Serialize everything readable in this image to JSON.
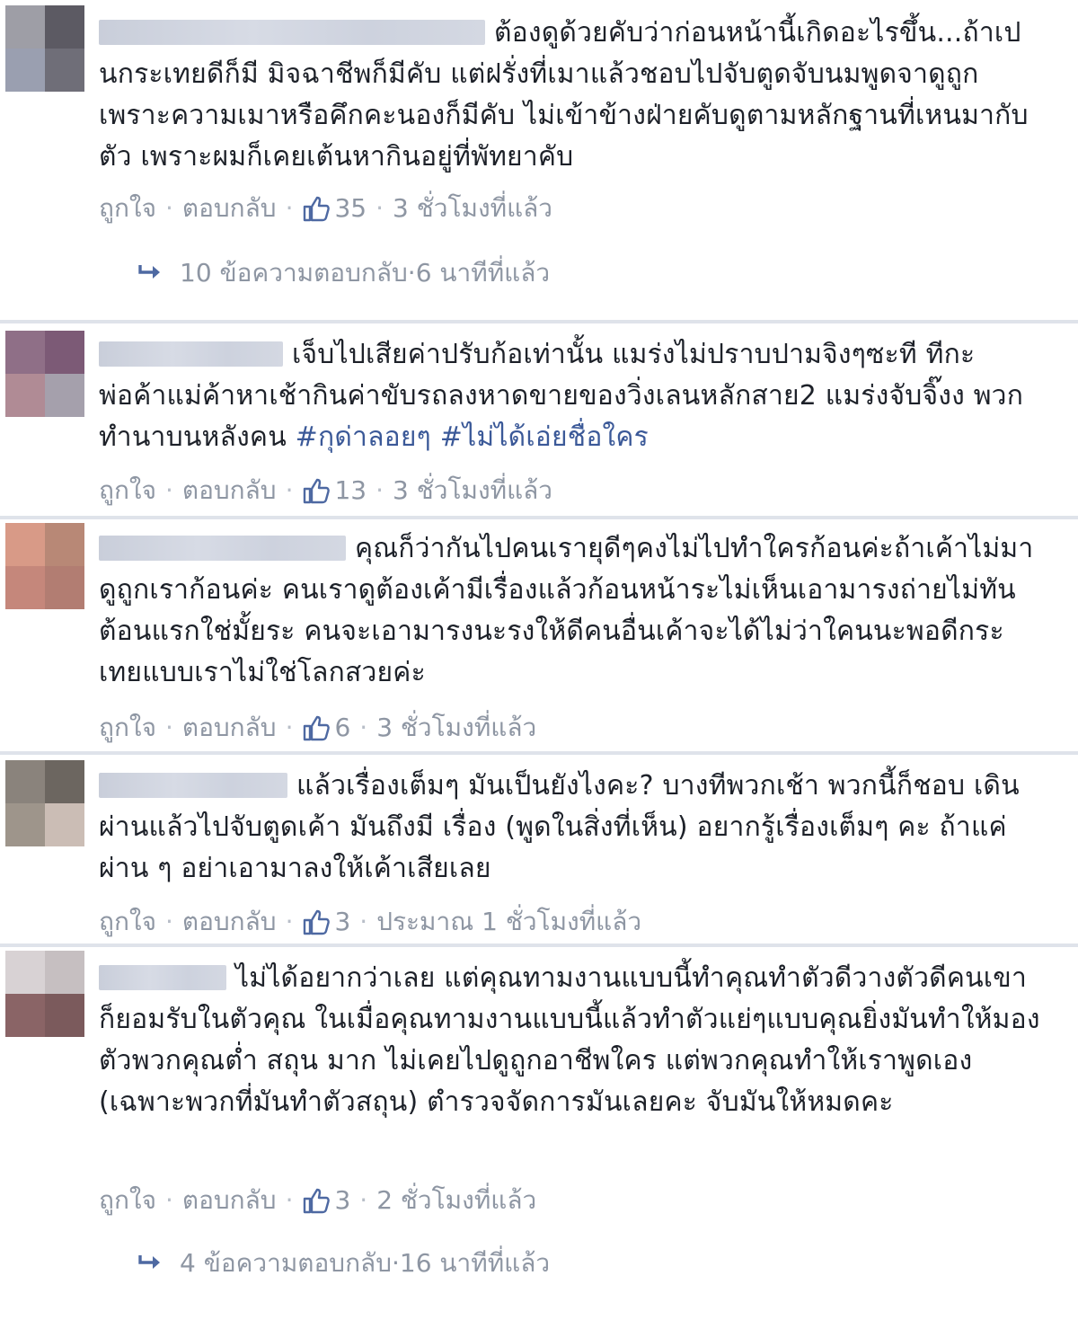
{
  "actions": {
    "like": "ถูกใจ",
    "reply": "ตอบกลับ",
    "separator": "·"
  },
  "colors": {
    "link": "#3b5998",
    "meta": "#8e96a3",
    "divider": "#dfe3ea"
  },
  "comments": [
    {
      "text": "ต้องดูด้วยคับว่าก่อนหน้านี้เกิดอะไรขึ้น...ถ้าเปนกระเทยดีก็มี มิจฉาชีพก็มีคับ แต่ฝรั่งที่เมาแล้วชอบไปจับตูดจับนมพูดจาดูถูกเพราะความเมาหรือคึกคะนองก็มีคับ ไม่เข้าข้างฝ่ายคับดูตามหลักฐานที่เหนมากับตัว เพราะผมก็เคยเต้นหากินอยู่ที่พัทยาคับ",
      "likes": "35",
      "time": "3 ชั่วโมงที่แล้ว",
      "replies": {
        "label": "10 ข้อความตอบกลับ",
        "time": "6 นาทีที่แล้ว"
      }
    },
    {
      "text": "เจ็บไปเสียค่าปรับก้อเท่านั้น แมร่งไม่ปราบปามจิงๆซะที ทีกะพ่อค้าแม่ค้าหาเช้ากินค่าขับรถลงหาดขายของวิ่งเลนหลักสาย2 แมร่งจับจิ๊งง พวกทำนาบนหลังคน",
      "hashtags": [
        "#กุด่าลอยๆ",
        "#ไม่ได้เอ่ยชื่อใคร"
      ],
      "likes": "13",
      "time": "3 ชั่วโมงที่แล้ว"
    },
    {
      "text": "คุณก็ว่ากันไปคนเรายุดีๆคงไม่ไปทำใครก้อนค่ะถ้าเค้าไม่มาดูถูกเราก้อนค่ะ คนเราดูต้องเค้ามีเรื่องแล้วก้อนหน้าระไม่เห็นเอามารงถ่ายไม่ทันต้อนแรกใช่มั้ยระ คนจะเอามารงนะรงให้ดีคนอื่นเค้าจะได้ไม่ว่าใคนนะพอดีกระเทยแบบเราไม่ใช่โลกสวยค่ะ",
      "likes": "6",
      "time": "3 ชั่วโมงที่แล้ว"
    },
    {
      "text": "แล้วเรื่องเต็มๆ มันเป็นยังไงคะ? บางทีพวกเช้า พวกนี้ก็ชอบ เดินผ่านแล้วไปจับตูดเค้า มันถึงมี เรื่อง (พูดในสิ่งที่เห็น) อยากรู้เรื่องเต็มๆ คะ ถ้าแค่ผ่าน ๆ อย่าเอามาลงให้เค้าเสียเลย",
      "likes": "3",
      "time": "ประมาณ 1 ชั่วโมงที่แล้ว"
    },
    {
      "text": "ไม่ได้อยากว่าเลย แต่คุณทามงานแบบนี้ทำคุณทำตัวดีวางตัวดีคนเขาก็ยอมรับในตัวคุณ ในเมื่อคุณทามงานแบบนี้แล้วทำตัวแย่ๆแบบคุณยิ่งมันทำให้มองตัวพวกคุณต่ำ สถุน มาก ไม่เคยไปดูถูกอาชีพใคร แต่พวกคุณทำให้เราพูดเอง (เฉพาะพวกที่มันทำตัวสถุน) ตำรวจจัดการมันเลยคะ จับมันให้หมดคะ",
      "likes": "3",
      "time": "2 ชั่วโมงที่แล้ว",
      "replies": {
        "label": "4 ข้อความตอบกลับ",
        "time": "16 นาทีที่แล้ว"
      }
    }
  ]
}
